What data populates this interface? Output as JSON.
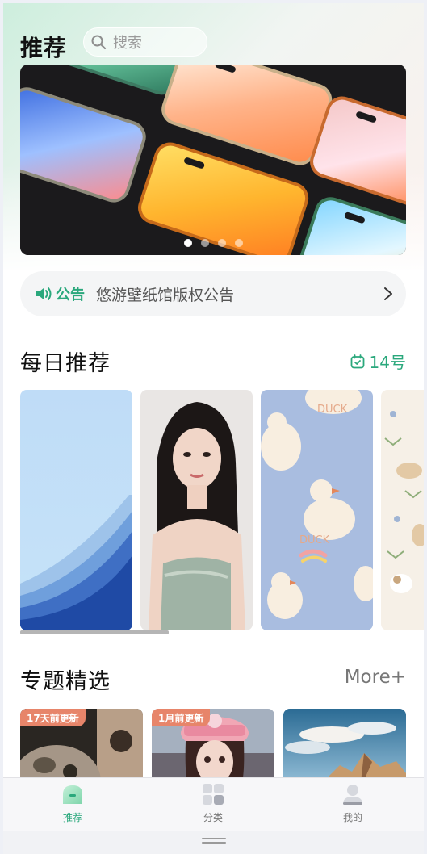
{
  "header": {
    "title": "推荐"
  },
  "search": {
    "placeholder": "搜索",
    "icon": "search-icon"
  },
  "banner": {
    "slides": 4,
    "active_slide": 1
  },
  "notice": {
    "tag": "公告",
    "text": "悠游壁纸馆版权公告",
    "icon": "speaker-icon"
  },
  "daily": {
    "title": "每日推荐",
    "date": "14号",
    "cards": 4,
    "scroll_fraction": 0.38
  },
  "topics": {
    "title": "专题精选",
    "more": "More+",
    "items": [
      {
        "badge": "17天前更新"
      },
      {
        "badge": "1月前更新"
      },
      {
        "badge": ""
      }
    ]
  },
  "tabbar": {
    "items": [
      {
        "label": "推荐",
        "icon": "home-icon",
        "active": true
      },
      {
        "label": "分类",
        "icon": "grid-icon",
        "active": false
      },
      {
        "label": "我的",
        "icon": "user-icon",
        "active": false
      }
    ]
  },
  "colors": {
    "accent": "#2aa87c",
    "badge": "#e7856a"
  }
}
